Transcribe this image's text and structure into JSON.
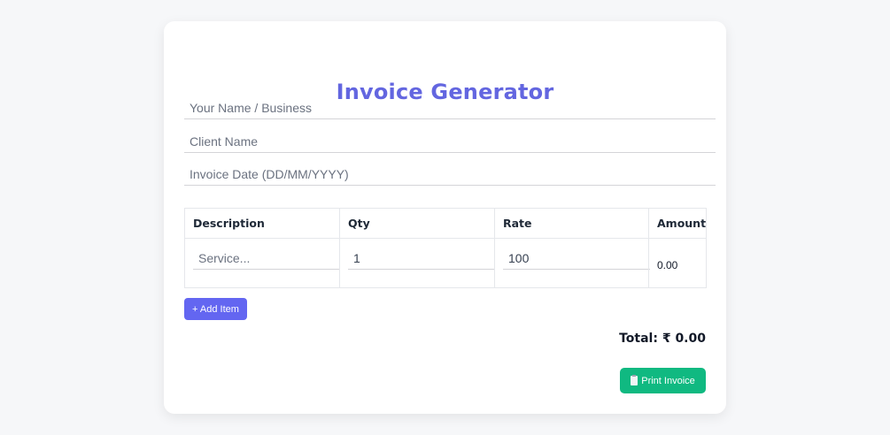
{
  "title": "Invoice Generator",
  "fields": {
    "business": {
      "placeholder": "Your Name / Business",
      "value": ""
    },
    "client": {
      "placeholder": "Client Name",
      "value": ""
    },
    "date": {
      "placeholder": "Invoice Date (DD/MM/YYYY)",
      "value": ""
    }
  },
  "table": {
    "headers": [
      "Description",
      "Qty",
      "Rate",
      "Amount"
    ],
    "rows": [
      {
        "description_placeholder": "Service...",
        "qty": "1",
        "rate": "100",
        "amount": "0.00"
      }
    ]
  },
  "add_item_label": "+ Add Item",
  "total_text": "Total: ₹ 0.00",
  "print_label": "Print Invoice",
  "colors": {
    "accent": "#6366f1",
    "success": "#10b981",
    "title": "#6366e0"
  }
}
